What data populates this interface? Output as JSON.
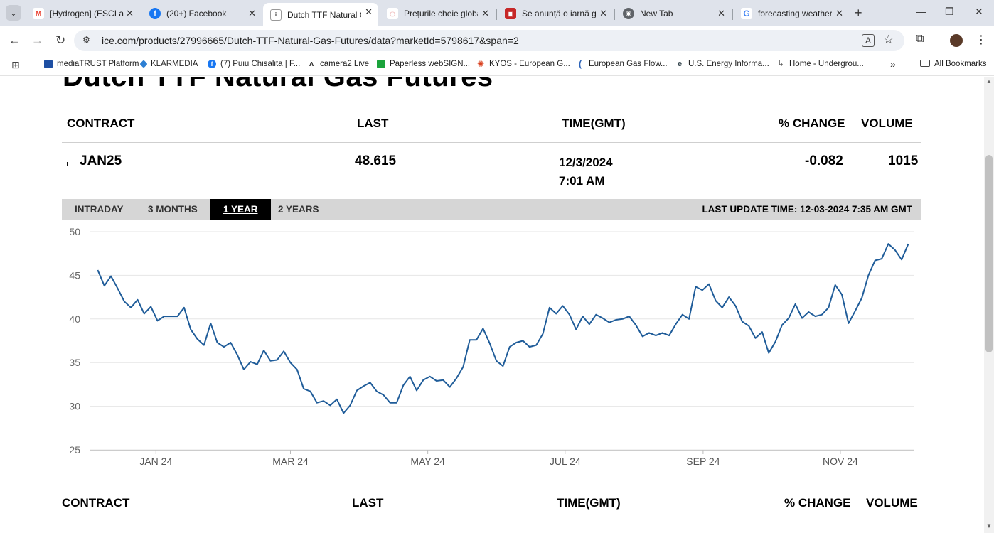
{
  "browser": {
    "tabs": [
      {
        "title": "[Hydrogen] (ESCI and",
        "icon": "gmail-icon",
        "color": "#ea4335",
        "glyph": "M"
      },
      {
        "title": "(20+) Facebook",
        "icon": "facebook-icon",
        "color": "#1877f2",
        "glyph": "f"
      },
      {
        "title": "Dutch TTF Natural G",
        "icon": "ice-icon",
        "color": "#555555",
        "glyph": "i"
      },
      {
        "title": "Prețurile cheie globa",
        "icon": "dotted-circle-icon",
        "color": "#e08080",
        "glyph": "◌"
      },
      {
        "title": "Se anunță o iarnă gre",
        "icon": "news-icon",
        "color": "#c62828",
        "glyph": "▣"
      },
      {
        "title": "New Tab",
        "icon": "chrome-icon",
        "color": "#5f6368",
        "glyph": "◉"
      },
      {
        "title": "forecasting weather",
        "icon": "google-icon",
        "color": "#4285f4",
        "glyph": "G"
      }
    ],
    "url": "ice.com/products/27996665/Dutch-TTF-Natural-Gas-Futures/data?marketId=5798617&span=2",
    "bookmarks": [
      {
        "label": "mediaTRUST Platform",
        "color": "#1e4fa3",
        "glyph": "▌"
      },
      {
        "label": "KLARMEDIA",
        "color": "#2d7fd3",
        "glyph": "◆"
      },
      {
        "label": "(7) Puiu Chisalita | F...",
        "color": "#1877f2",
        "glyph": "f"
      },
      {
        "label": "camera2 Live",
        "color": "#333333",
        "glyph": "ʌ"
      },
      {
        "label": "Paperless webSIGN...",
        "color": "#1aa33b",
        "glyph": "▮"
      },
      {
        "label": "KYOS - European G...",
        "color": "#d9401f",
        "glyph": "✺"
      },
      {
        "label": "European Gas Flow...",
        "color": "#2b62b8",
        "glyph": "("
      },
      {
        "label": "U.S. Energy Informa...",
        "color": "#37474f",
        "glyph": "e"
      },
      {
        "label": "Home - Undergrou...",
        "color": "#666666",
        "glyph": "↳"
      }
    ],
    "all_bookmarks": "All Bookmarks"
  },
  "page": {
    "title": "Dutch TTF Natural Gas Futures",
    "columns": {
      "contract": "CONTRACT",
      "last": "LAST",
      "time": "TIME(GMT)",
      "change": "% CHANGE",
      "volume": "VOLUME"
    },
    "row": {
      "contract": "JAN25",
      "last": "48.615",
      "date": "12/3/2024",
      "time": "7:01 AM",
      "change": "-0.082",
      "volume": "1015"
    },
    "ranges": [
      "INTRADAY",
      "3 MONTHS",
      "1 YEAR",
      "2 YEARS"
    ],
    "active_range": "1 YEAR",
    "last_update": "LAST UPDATE TIME: 12-03-2024 7:35 AM GMT"
  },
  "chart_data": {
    "type": "line",
    "line_color": "#1f5c99",
    "ylim": [
      25,
      50
    ],
    "yticks": [
      25,
      30,
      35,
      40,
      45,
      50
    ],
    "xtick_labels": [
      "JAN 24",
      "MAR 24",
      "MAY 24",
      "JUL 24",
      "SEP 24",
      "NOV 24"
    ],
    "xtick_positions": [
      0.0797,
      0.2431,
      0.4099,
      0.5767,
      0.7443,
      0.911
    ],
    "x_start": "2023-12-04",
    "x_end": "2024-12-03",
    "series": [
      {
        "name": "JAN25",
        "values": [
          45.6,
          43.8,
          44.9,
          43.5,
          42.0,
          41.3,
          42.2,
          40.6,
          41.4,
          39.8,
          40.3,
          40.3,
          40.3,
          41.3,
          38.8,
          37.7,
          37.0,
          39.5,
          37.3,
          36.8,
          37.3,
          35.9,
          34.2,
          35.1,
          34.8,
          36.4,
          35.2,
          35.3,
          36.3,
          35.0,
          34.2,
          32.0,
          31.7,
          30.4,
          30.6,
          30.1,
          30.8,
          29.2,
          30.1,
          31.8,
          32.3,
          32.7,
          31.7,
          31.3,
          30.4,
          30.4,
          32.4,
          33.4,
          31.8,
          33.0,
          33.4,
          32.9,
          33.0,
          32.2,
          33.2,
          34.5,
          37.6,
          37.6,
          38.9,
          37.2,
          35.2,
          34.6,
          36.8,
          37.3,
          37.5,
          36.8,
          37.0,
          38.3,
          41.3,
          40.6,
          41.5,
          40.5,
          38.8,
          40.3,
          39.4,
          40.5,
          40.1,
          39.6,
          39.9,
          40.0,
          40.3,
          39.3,
          38.0,
          38.4,
          38.1,
          38.4,
          38.1,
          39.4,
          40.5,
          40.0,
          43.7,
          43.3,
          44.0,
          42.1,
          41.3,
          42.5,
          41.5,
          39.7,
          39.2,
          37.8,
          38.5,
          36.1,
          37.4,
          39.3,
          40.1,
          41.7,
          40.1,
          40.8,
          40.3,
          40.5,
          41.3,
          43.9,
          42.8,
          39.5,
          40.9,
          42.4,
          45.0,
          46.7,
          46.9,
          48.6,
          47.9,
          46.8,
          48.6
        ]
      }
    ]
  }
}
